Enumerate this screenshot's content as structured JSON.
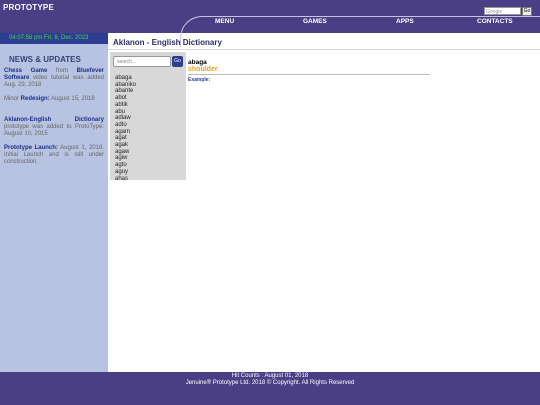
{
  "header": {
    "brand": "PROTOTYPE",
    "google_placeholder": "Google",
    "google_button": "Go",
    "nav": [
      "MENU",
      "GAMES",
      "APPS",
      "CONTACTS"
    ]
  },
  "sidebar": {
    "clock": "04:07:56 pm Fri. 8, Dec. 2023",
    "news_title": "NEWS & UPDATES",
    "news": [
      {
        "pre": "",
        "bold1": "Chess Game",
        "mid": " from ",
        "bold2": "Bluefever Software",
        "post": " video tutorial was added Aug. 29, 2018"
      },
      {
        "pre": "Minor ",
        "bold1": "Redesign:",
        "mid": " August 15, 2018",
        "bold2": "",
        "post": ""
      },
      {
        "pre": "",
        "bold1": "Aklanon-English Dictionary",
        "mid": " prototype was added to ProtoType: August 10, 2015",
        "bold2": "",
        "post": ""
      },
      {
        "pre": "",
        "bold1": "Prototype Launch:",
        "mid": " August 1, 2018. Initial Launch and is still under construction.",
        "bold2": "",
        "post": ""
      }
    ]
  },
  "main": {
    "title": "Aklanon - English Dictionary",
    "search_placeholder": "search...",
    "search_button": "Go",
    "words": [
      "abaga",
      "abaniko",
      "abante",
      "abot",
      "abtik",
      "abu",
      "adlaw",
      "adto",
      "agam",
      "agat",
      "agak",
      "agaw",
      "agiw",
      "agto",
      "aguy",
      "ahas"
    ],
    "entry": {
      "term": "abaga",
      "meaning": "shoulder",
      "example_label": "Example:"
    }
  },
  "footer": {
    "hits": "Hit Counts :     August 01, 2018",
    "copyright": "Jenuine® Prototype Ltd. 2018 © Copyright. All Rights Reserved"
  }
}
